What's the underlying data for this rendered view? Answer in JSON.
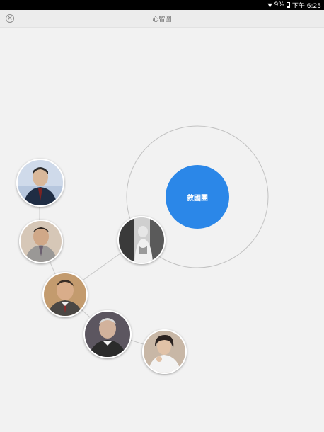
{
  "status_bar": {
    "wifi_icon": "wifi-icon",
    "battery_percent": "9%",
    "battery_icon": "battery-icon",
    "time": "下午 6:25"
  },
  "title_bar": {
    "close_icon": "close-icon",
    "title": "心智圖"
  },
  "mind_map": {
    "center": {
      "label": "救國團",
      "color": "#2b87e8"
    },
    "nodes": [
      {
        "name": "person-node-1",
        "kind": "photo"
      },
      {
        "name": "person-node-2",
        "kind": "photo"
      },
      {
        "name": "person-node-3",
        "kind": "photo"
      },
      {
        "name": "person-node-4",
        "kind": "photo"
      },
      {
        "name": "person-node-5",
        "kind": "photo"
      },
      {
        "name": "person-node-6",
        "kind": "photo"
      }
    ]
  }
}
